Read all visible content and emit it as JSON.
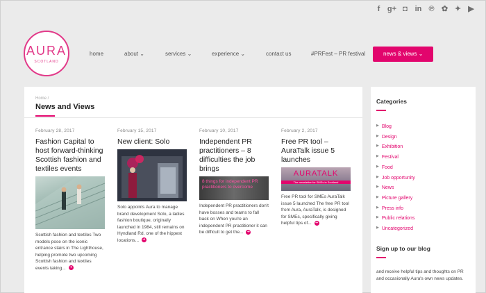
{
  "social": [
    {
      "icon": "facebook-icon",
      "glyph": "f"
    },
    {
      "icon": "google-plus-icon",
      "glyph": "g+"
    },
    {
      "icon": "instagram-icon",
      "glyph": "◘"
    },
    {
      "icon": "linkedin-icon",
      "glyph": "in"
    },
    {
      "icon": "pinterest-icon",
      "glyph": "℗"
    },
    {
      "icon": "foursquare-icon",
      "glyph": "✿"
    },
    {
      "icon": "twitter-icon",
      "glyph": "✦"
    },
    {
      "icon": "youtube-icon",
      "glyph": "▶"
    }
  ],
  "logo": {
    "name": "AURA",
    "tagline": "SCOTLAND"
  },
  "nav": {
    "home": "home",
    "about": "about",
    "services": "services",
    "experience": "experience",
    "contact": "contact us",
    "prfest": "#PRFest – PR festival",
    "news": "news & views",
    "chevron": "⌄"
  },
  "breadcrumb": "Home /",
  "page_title": "News and Views",
  "posts": [
    {
      "date": "February 28, 2017",
      "title": "Fashion Capital to host forward-thinking Scottish fashion and textiles events",
      "excerpt": "Scottish fashion and textiles Two models pose on the iconic entrance stairs in The Lighthouse, helping promote two upcoming Scottish fashion and textiles events taking..."
    },
    {
      "date": "February 15, 2017",
      "title": "New client: Solo",
      "excerpt": "Solo appoints Aura to manage brand development Solo, a ladies fashion boutique, originally launched in 1984, still remains on Hyndland Rd, one of the hippest locations..."
    },
    {
      "date": "February 10, 2017",
      "title": "Independent PR practitioners – 8 difficulties the job brings",
      "img_text": "8 things for independent PR practitioners to overcome",
      "excerpt": "Independent PR practitioners don't have bosses and teams to fall back on When you're an independent PR practitioner it can be difficult to get the..."
    },
    {
      "date": "February 2, 2017",
      "title": "Free PR tool – AuraTalk issue 5 launches",
      "img_text": "AURATALK",
      "img_sub": "The newsletter for SMEs in Scotland",
      "excerpt": "Free PR tool for SMEs AuraTalk issue 5 launched The free PR tool from Aura, AuraTalk, is designed for SMEs, specifically giving helpful tips of..."
    }
  ],
  "read_more_icon": "➜",
  "sidebar": {
    "categories_title": "Categories",
    "categories": [
      "Blog",
      "Design",
      "Exhibition",
      "Festival",
      "Food",
      "Job opportunity",
      "News",
      "Picture gallery",
      "Press info",
      "Public relations",
      "Uncategorized"
    ],
    "bullet": "▶",
    "signup_title": "Sign up to our blog",
    "signup_text": "and receive helpful tips and thoughts on PR and occasionally Aura's own news updates."
  }
}
